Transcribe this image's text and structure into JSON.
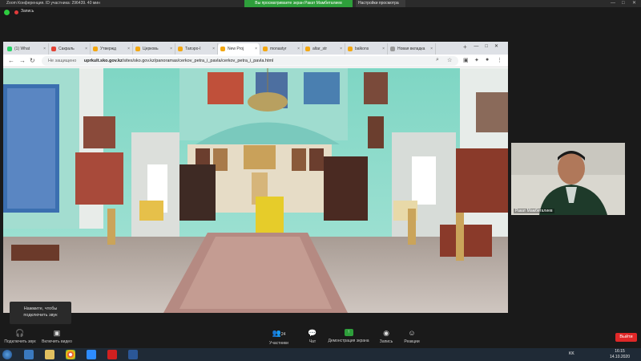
{
  "zoom": {
    "window_title": "Zoom Конференция. ID участника: 296439. 40 мин",
    "share_banner": "Вы просматриваете экран Ракат Мамбеталиев",
    "view_settings": "Настройки просмотра",
    "recording_label": "Запись"
  },
  "browser": {
    "tabs": [
      {
        "label": "(1) What",
        "color": "#25d366"
      },
      {
        "label": "Сакраль",
        "color": "#e34234"
      },
      {
        "label": "Утвержд",
        "color": "#f3a712"
      },
      {
        "label": "Церковь",
        "color": "#f3a712"
      },
      {
        "label": "Тапэро-I",
        "color": "#f3a712"
      },
      {
        "label": "New Proj",
        "color": "#f3a712"
      },
      {
        "label": "monastyr",
        "color": "#f3a712"
      },
      {
        "label": "altar_str",
        "color": "#f3a712"
      },
      {
        "label": "balkons",
        "color": "#f3a712"
      },
      {
        "label": "Новая вкладка",
        "color": "#999999"
      }
    ],
    "active_tab_index": 5,
    "security_label": "Не защищено",
    "url_domain": "uprkult.sko.gov.kz",
    "url_path": "/sites/sko.gov.kz/panoramas/cerkov_petra_i_pavla/cerkov_petra_i_pavla.html"
  },
  "pano_toolbar": {
    "icons": [
      "zoom-in-icon",
      "zoom-out-icon",
      "arrow-up-icon",
      "arrow-down-icon",
      "arrow-left-icon",
      "arrow-right-icon",
      "hand-icon",
      "rotate-icon",
      "fullscreen-icon",
      "screen-icon"
    ]
  },
  "participant": {
    "name": "Ракат Мамбеталиев"
  },
  "tooltip": {
    "line1": "Нажмите, чтобы",
    "line2": "подключить звук"
  },
  "controls": {
    "audio": "Подключить звук",
    "video": "Включить видео",
    "participants": "Участники",
    "participants_count": "24",
    "chat": "Чат",
    "share": "Демонстрация экрана",
    "record": "Запись",
    "reactions": "Реакции",
    "leave": "Выйти"
  },
  "taskbar": {
    "lang": "KK",
    "time": "16:15",
    "date": "14.10.2020"
  }
}
